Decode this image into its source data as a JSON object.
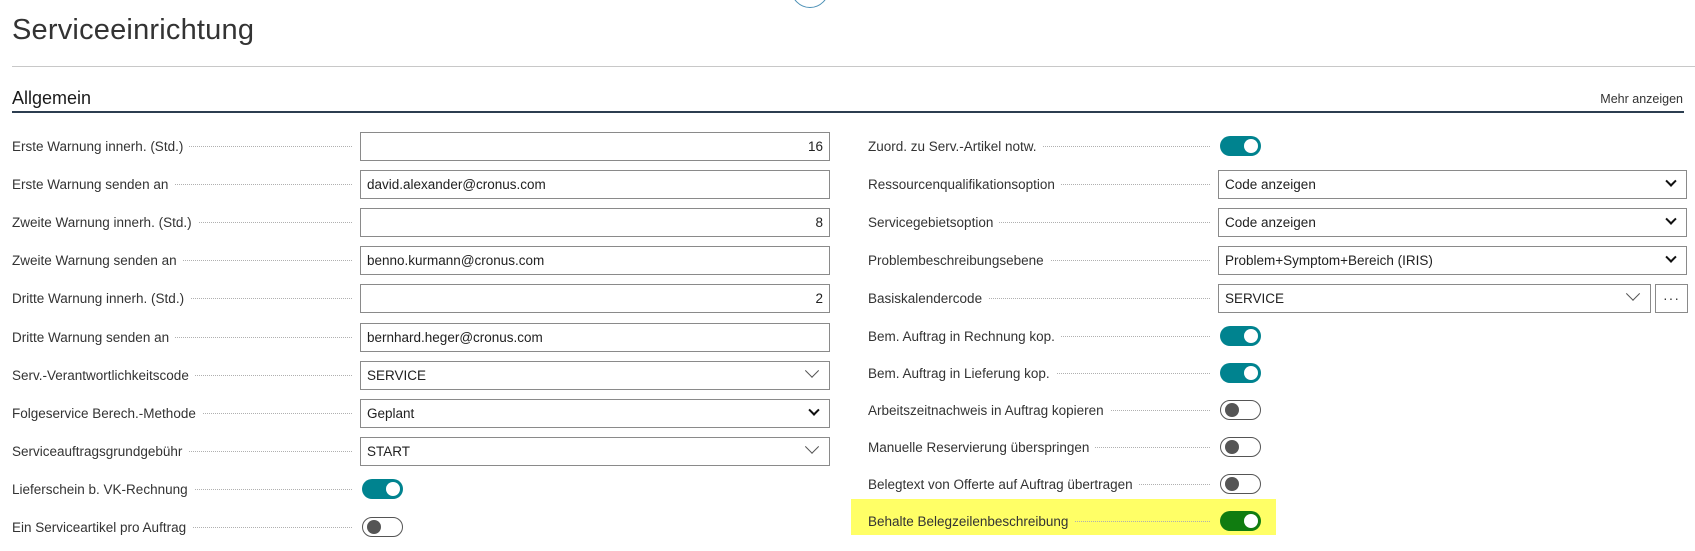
{
  "page": {
    "title": "Serviceeinrichtung"
  },
  "section": {
    "title": "Allgemein",
    "show_more": "Mehr anzeigen"
  },
  "left_fields": [
    {
      "label": "Erste Warnung innerh. (Std.)",
      "value": "16"
    },
    {
      "label": "Erste Warnung senden an",
      "value": "david.alexander@cronus.com"
    },
    {
      "label": "Zweite Warnung innerh. (Std.)",
      "value": "8"
    },
    {
      "label": "Zweite Warnung senden an",
      "value": "benno.kurmann@cronus.com"
    },
    {
      "label": "Dritte Warnung innerh. (Std.)",
      "value": "2"
    },
    {
      "label": "Dritte Warnung senden an",
      "value": "bernhard.heger@cronus.com"
    },
    {
      "label": "Serv.-Verantwortlichkeitscode",
      "value": "SERVICE"
    },
    {
      "label": "Folgeservice Berech.-Methode",
      "value": "Geplant"
    },
    {
      "label": "Serviceauftragsgrundgebühr",
      "value": "START"
    },
    {
      "label": "Lieferschein b. VK-Rechnung",
      "value": true
    },
    {
      "label": "Ein Serviceartikel pro Auftrag",
      "value": false
    }
  ],
  "right_fields": [
    {
      "label": "Zuord. zu Serv.-Artikel notw.",
      "value": true
    },
    {
      "label": "Ressourcenqualifikationsoption",
      "value": "Code anzeigen"
    },
    {
      "label": "Servicegebietsoption",
      "value": "Code anzeigen"
    },
    {
      "label": "Problembeschreibungsebene",
      "value": "Problem+Symptom+Bereich (IRIS)"
    },
    {
      "label": "Basiskalendercode",
      "value": "SERVICE",
      "button": "···"
    },
    {
      "label": "Bem. Auftrag in Rechnung kop.",
      "value": true
    },
    {
      "label": "Bem. Auftrag in Lieferung kop.",
      "value": true
    },
    {
      "label": "Arbeitszeitnachweis in Auftrag kopieren",
      "value": false
    },
    {
      "label": "Manuelle Reservierung überspringen",
      "value": false
    },
    {
      "label": "Belegtext von Offerte auf Auftrag übertragen",
      "value": false
    },
    {
      "label": "Behalte Belegzeilenbeschreibung",
      "value": true
    }
  ],
  "colors": {
    "toggle_on": "#00838f",
    "toggle_on_highlight": "#107c10",
    "highlight": "#ffff66"
  }
}
